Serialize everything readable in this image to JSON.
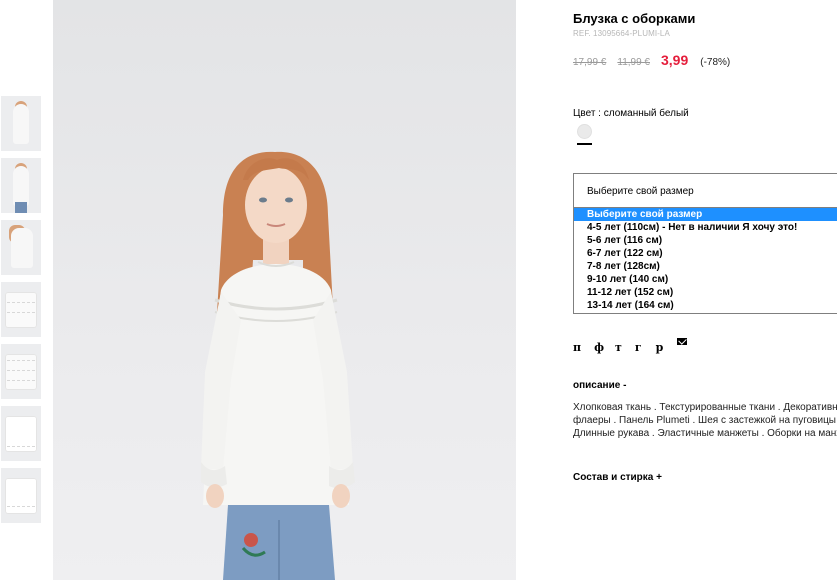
{
  "product": {
    "title": "Блузка с оборками",
    "ref": "REF. 13095664-PLUMI-LA",
    "price_original": "17,99 €",
    "price_previous": "11,99 €",
    "price_current": "3,99",
    "discount": "(-78%)"
  },
  "color": {
    "label": "Цвет : сломанный белый",
    "swatch_color": "#eaeaea"
  },
  "size": {
    "placeholder": "Выберите свой размер",
    "options": [
      "Выберите свой размер",
      "4-5 лет (110см) - Нет в наличии Я хочу это!",
      "5-6 лет (116 см)",
      "6-7 лет (122 см)",
      "7-8 лет (128см)",
      "9-10 лет (140 см)",
      "11-12 лет (152 см)",
      "13-14 лет (164 см)"
    ],
    "selected_index": 0
  },
  "share": {
    "icons": [
      "п",
      "ф",
      "т",
      "г",
      "р"
    ],
    "mail_icon": "envelope-icon"
  },
  "description": {
    "heading": "описание -",
    "lines": [
      "Хлопковая ткань . Текстурированные ткани . Декоративные",
      "флаеры . Панель Plumeti . Шея с застежкой на пуговицы .",
      "Длинные рукава . Эластичные манжеты . Оборки на манже"
    ]
  },
  "composition": {
    "heading": "Состав и стирка +"
  },
  "colors": {
    "accent_price": "#e51e3c",
    "selected_option": "#1e90ff",
    "photo_background": "#e8e9eb"
  }
}
